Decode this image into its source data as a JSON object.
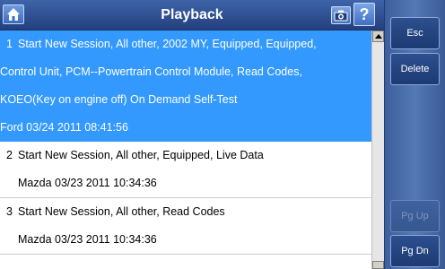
{
  "title": "Playback",
  "icons": {
    "home": "home-icon",
    "camera": "camera-icon",
    "help": "?"
  },
  "entries": [
    {
      "number": "1",
      "selected": true,
      "lines": [
        "Start New Session, All other, 2002 MY, Equipped, Equipped,",
        "Control Unit, PCM--Powertrain Control Module, Read Codes,",
        "KOEO(Key on engine off) On Demand Self-Test",
        "Ford 03/24 2011 08:41:56"
      ]
    },
    {
      "number": "2",
      "selected": false,
      "lines": [
        "Start New Session, All other, Equipped, Live Data",
        "Mazda 03/23 2011 10:34:36"
      ]
    },
    {
      "number": "3",
      "selected": false,
      "lines": [
        "Start New Session, All other, Read Codes",
        "Mazda 03/23 2011 10:34:36"
      ]
    }
  ],
  "buttons": {
    "esc": "Esc",
    "delete": "Delete",
    "pg_up": "Pg Up",
    "pg_dn": "Pg Dn"
  },
  "colors": {
    "selected_row": "#3399ff",
    "title_bar": "#2f5294",
    "side_panel": "#4a6ca8"
  }
}
